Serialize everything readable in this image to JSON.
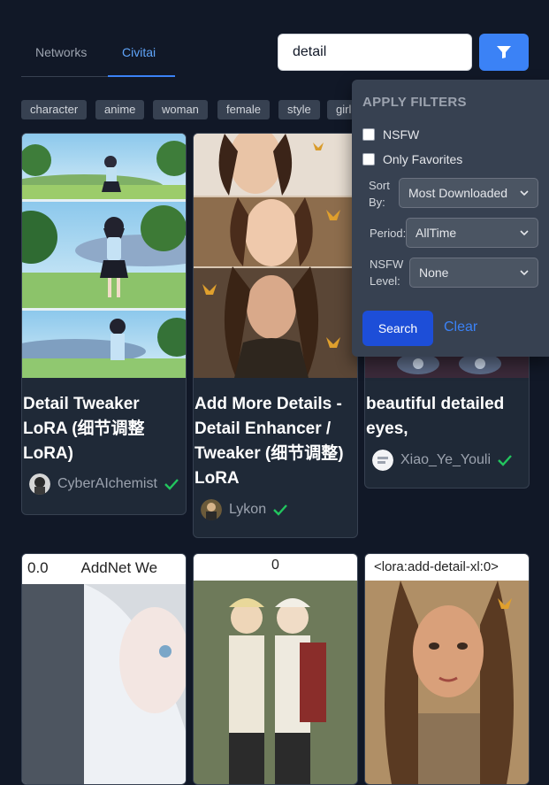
{
  "tabs": [
    {
      "label": "Networks"
    },
    {
      "label": "Civitai"
    }
  ],
  "search": {
    "value": "detail"
  },
  "tags": [
    "character",
    "anime",
    "woman",
    "female",
    "style",
    "girl"
  ],
  "cards": [
    {
      "title": "Detail Tweaker LoRA (细节调整LoRA)",
      "creator": "CyberAIchemist",
      "verified": true
    },
    {
      "title": "Add More Details - Detail Enhancer / Tweaker (细节调整) LoRA",
      "creator": "Lykon",
      "verified": true
    },
    {
      "title": "beautiful detailed eyes,",
      "creator": "Xiao_Ye_Youli",
      "verified": true
    },
    {
      "image_text": "0.0        AddNet We"
    },
    {
      "image_text": "0"
    },
    {
      "image_text": "<lora:add-detail-xl:0>"
    }
  ],
  "filters": {
    "title": "APPLY FILTERS",
    "nsfw_label": "NSFW",
    "favorites_label": "Only Favorites",
    "sort_label": "Sort By:",
    "sort_value": "Most Downloaded",
    "period_label": "Period:",
    "period_value": "AllTime",
    "level_label": "NSFW Level:",
    "level_value": "None",
    "search_label": "Search",
    "clear_label": "Clear"
  },
  "colors": {
    "accent": "#3b82f6",
    "verified": "#22c55e",
    "background": "#111827",
    "card": "#1f2937"
  }
}
